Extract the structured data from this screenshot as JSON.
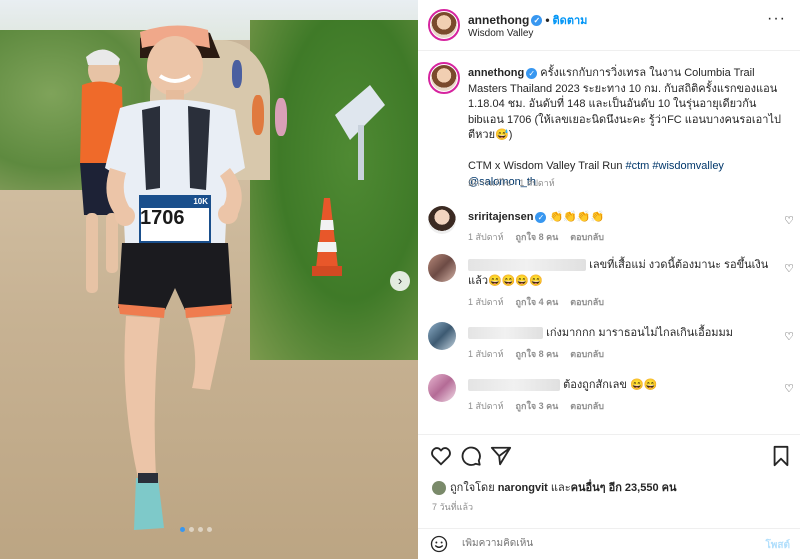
{
  "post": {
    "username": "annethong",
    "follow_label": "ติดตาม",
    "location": "Wisdom Valley",
    "more_icon": "more-icon",
    "separator": "•"
  },
  "caption": {
    "username": "annethong",
    "text": "ครั้งแรกกับการวิ่งเทรล ในงาน Columbia Trail Masters Thailand 2023 ระยะทาง 10 กม. กับสถิติครั้งแรกของแอน 1.18.04 ชม. อันดับที่ 148 และเป็นอันดับ 10 ในรุ่นอายุเดียวกัน bibแอน 1706 (ให้เลขเยอะนิดนึงนะคะ รู้ว่าFC แอนบางคนรอเอาไปตีหวย😅)",
    "line2_prefix": "CTM x Wisdom Valley Trail Run ",
    "hashtag1": "#ctm",
    "hashtag2": "#wisdomvalley",
    "mention": "@salomon_th",
    "meta": "มีการแก้ไข · 1 สัปดาห์"
  },
  "comments": [
    {
      "username": "sriritajensen",
      "text": "👏👏👏👏",
      "time": "1 สัปดาห์",
      "likes": "ถูกใจ 8 คน",
      "reply": "ตอบกลับ"
    },
    {
      "username": "",
      "text": "เลขที่เสื้อแม่ งวดนี้ต้องมานะ รอขึ้นเงินแล้ว😄😄😄😄",
      "time": "1 สัปดาห์",
      "likes": "ถูกใจ 4 คน",
      "reply": "ตอบกลับ"
    },
    {
      "username": "",
      "text": "เก่งมากกก มาราธอนไม่ไกลเกินเอื้อมมม",
      "time": "1 สัปดาห์",
      "likes": "ถูกใจ 8 คน",
      "reply": "ตอบกลับ"
    },
    {
      "username": "",
      "text": "ต้องถูกสักเลข 😄😄",
      "time": "1 สัปดาห์",
      "likes": "ถูกใจ 3 คน",
      "reply": "ตอบกลับ"
    }
  ],
  "likes": {
    "prefix": "ถูกใจโดย ",
    "user": "narongvit",
    "middle": " และ",
    "others": "คนอื่นๆ อีก 23,550 คน"
  },
  "time_ago": "7 วันที่แล้ว",
  "add_comment": {
    "placeholder": "เพิ่มความคิดเห็น",
    "post_label": "โพสต์"
  },
  "photo": {
    "bib_number": "1706",
    "bib_top": "10K",
    "carousel_dots": 4,
    "active_dot": 0
  },
  "colors": {
    "accent": "#0095f6",
    "verified": "#3897f0",
    "link": "#00376b",
    "muted": "#8e8e8e"
  }
}
